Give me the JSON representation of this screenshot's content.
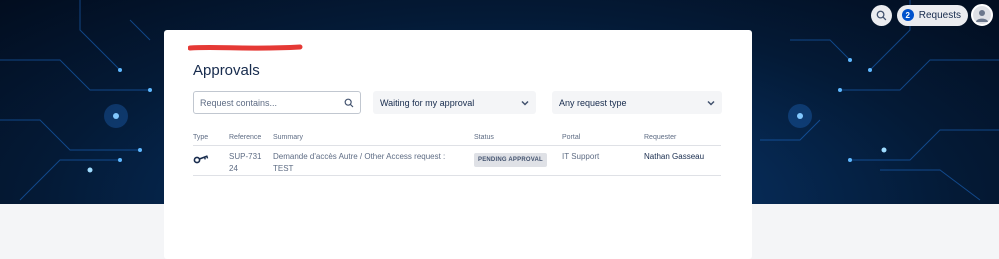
{
  "header": {
    "requests_label": "Requests",
    "requests_count": "2",
    "search_icon": "search-icon",
    "avatar_icon": "user-avatar-icon"
  },
  "page": {
    "title": "Approvals"
  },
  "filters": {
    "search_placeholder": "Request contains...",
    "status_value": "Waiting for my approval",
    "type_value": "Any request type"
  },
  "table": {
    "columns": [
      "Type",
      "Reference",
      "Summary",
      "Status",
      "Portal",
      "Requester"
    ],
    "rows": [
      {
        "type_icon": "key-icon",
        "reference": "SUP-73124",
        "summary": "Demande d'accès Autre / Other Access request : TEST",
        "status": "PENDING APPROVAL",
        "portal": "IT Support",
        "requester": "Nathan Gasseau"
      }
    ]
  },
  "colors": {
    "hero_dark": "#020d1f",
    "hero_glow": "#0a3f7a",
    "accent": "#0052cc",
    "redaction": "#e53935"
  }
}
